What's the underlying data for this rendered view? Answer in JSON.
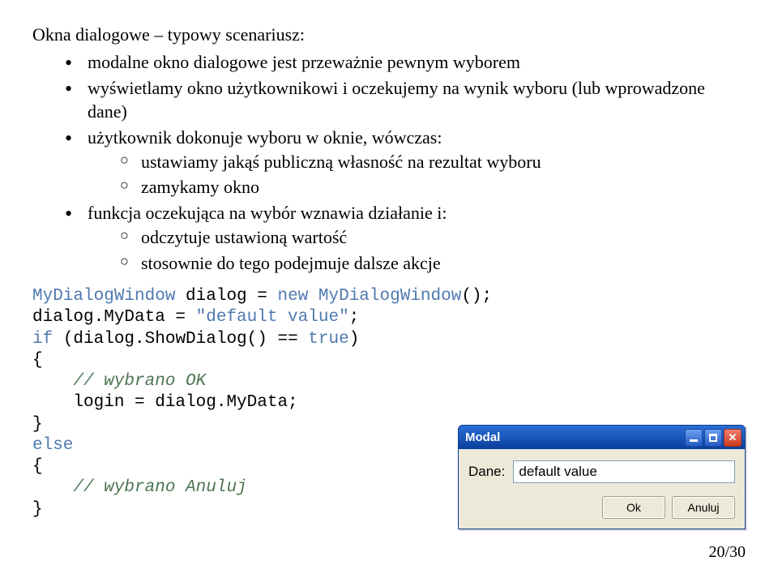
{
  "heading": "Okna dialogowe – typowy scenariusz:",
  "bullets": [
    "modalne okno dialogowe jest przeważnie pewnym wyborem",
    "wyświetlamy okno użytkownikowi i oczekujemy na wynik wyboru (lub wprowadzone dane)",
    "użytkownik dokonuje wyboru w oknie, wówczas:",
    "funkcja oczekująca na wybór wznawia działanie i:"
  ],
  "sub1": [
    "ustawiamy jakąś publiczną własność na rezultat wyboru",
    "zamykamy okno"
  ],
  "sub2": [
    "odczytuje ustawioną wartość",
    "stosownie do tego podejmuje dalsze akcje"
  ],
  "code": {
    "t1": "MyDialogWindow",
    "t2": " dialog = ",
    "t3": "new",
    "t4": " ",
    "t5": "MyDialogWindow",
    "t6": "();",
    "l2a": "dialog.MyData = ",
    "l2b": "\"default value\"",
    "l2c": ";",
    "l3a": "if",
    "l3b": " (dialog.ShowDialog() == ",
    "l3c": "true",
    "l3d": ")",
    "l4": "{",
    "l5": "    // wybrano OK",
    "l6": "    login = dialog.MyData;",
    "l7": "}",
    "l8": "else",
    "l9": "{",
    "l10": "    // wybrano Anuluj",
    "l11": "}"
  },
  "dialog": {
    "title": "Modal",
    "label": "Dane:",
    "value": "default value",
    "ok": "Ok",
    "cancel": "Anuluj"
  },
  "page": "20/30"
}
